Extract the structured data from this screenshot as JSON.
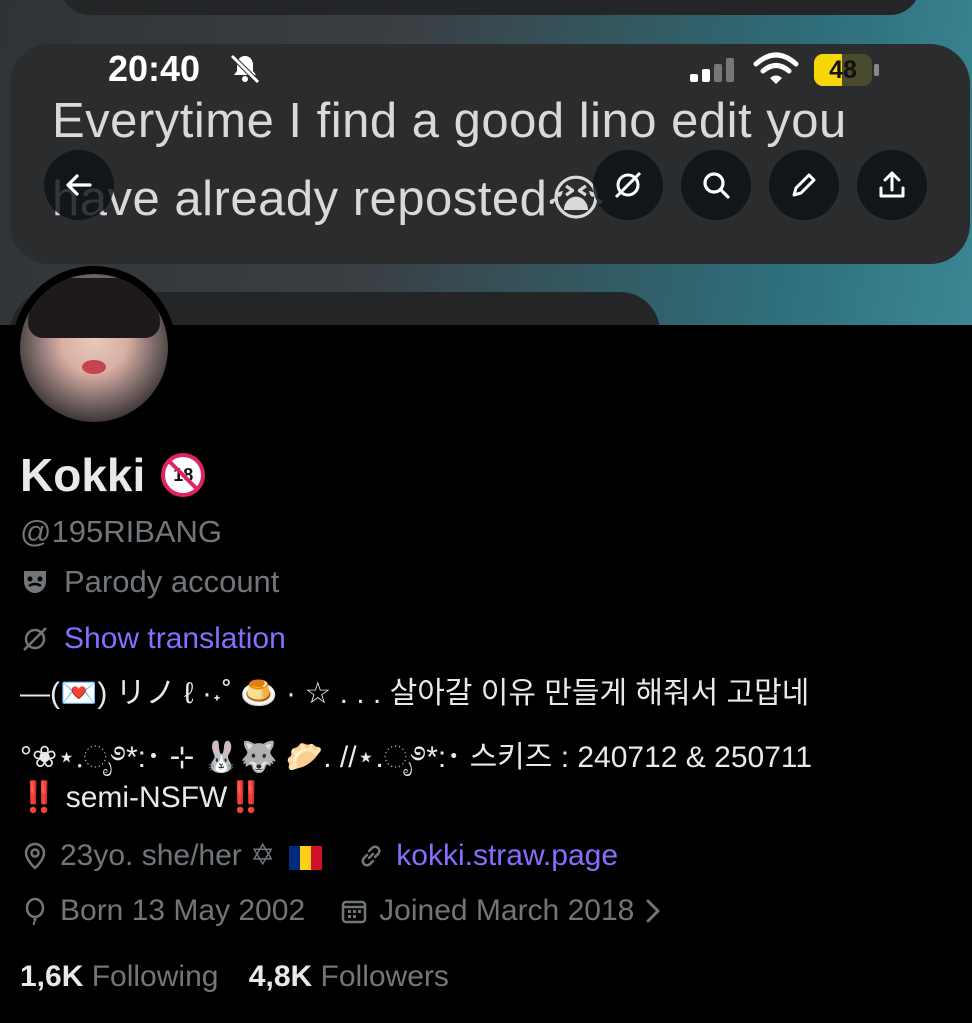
{
  "status_bar": {
    "time": "20:40",
    "battery_level": "48",
    "battery_fraction": 0.48
  },
  "banner": {
    "text": "Everytime I find a good lino edit you have already reposted😭"
  },
  "header_buttons": {
    "back": "back-arrow-icon",
    "search": "search-icon",
    "edit": "pencil-icon",
    "share": "share-icon"
  },
  "profile": {
    "display_name": "Kokki",
    "handle": "@195RIBANG",
    "parody_label": "Parody account",
    "show_translation": "Show translation",
    "bio": [
      "—(💌) リノ ℓ ·˖˚ 🍮 · ☆ . . . 살아갈 이유 만들게 해줘서 고맙네",
      "°❀⋆.ೃ࿔*:･ ⊹ 🐰🐺 🥟. //⋆.ೃ࿔*:･ 스키즈 : 240712 & 250711",
      "‼️ semi-NSFW‼️"
    ],
    "location": "23yo. she/her ✡︎",
    "link": "kokki.straw.page",
    "birthday": "Born 13 May 2002",
    "joined": "Joined March 2018",
    "following_count": "1,6K",
    "following_label": "Following",
    "followers_count": "4,8K",
    "followers_label": "Followers"
  },
  "colors": {
    "accent": "#8a6cff",
    "muted": "#71767b",
    "text": "#e7e9ea",
    "battery": "#f6d70a"
  }
}
